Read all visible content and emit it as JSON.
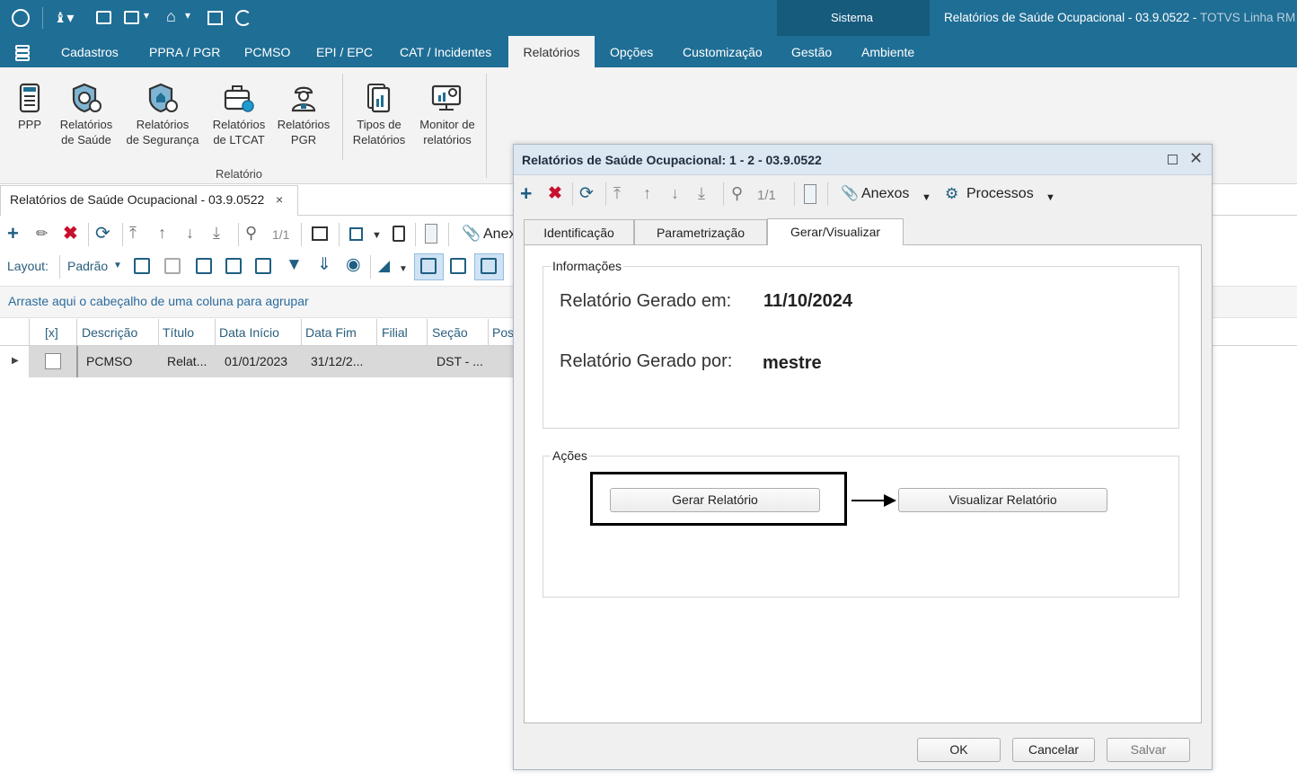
{
  "titlebar": {
    "sistema": "Sistema",
    "app_title": "Relatórios de Saúde Ocupacional - 03.9.0522 - ",
    "app_title_suffix": "TOTVS Linha RM"
  },
  "menu": {
    "items": [
      "Cadastros",
      "PPRA / PGR",
      "PCMSO",
      "EPI / EPC",
      "CAT / Incidentes",
      "Relatórios",
      "Opções",
      "Customização",
      "Gestão",
      "Ambiente"
    ],
    "active": "Relatórios"
  },
  "ribbon": {
    "buttons": [
      {
        "label1": "PPP",
        "label2": "",
        "icon": "ppp-document-icon"
      },
      {
        "label1": "Relatórios",
        "label2": "de Saúde",
        "icon": "health-shield-icon"
      },
      {
        "label1": "Relatórios",
        "label2": "de Segurança",
        "icon": "safety-shield-icon"
      },
      {
        "label1": "Relatórios",
        "label2": "de LTCAT",
        "icon": "briefcase-gear-icon"
      },
      {
        "label1": "Relatórios",
        "label2": "PGR",
        "icon": "worker-icon"
      },
      {
        "label1": "Tipos de",
        "label2": "Relatórios",
        "icon": "report-types-icon"
      },
      {
        "label1": "Monitor de",
        "label2": "relatórios",
        "icon": "monitor-search-icon"
      }
    ],
    "group_label": "Relatório"
  },
  "doc_tab": {
    "label": "Relatórios de Saúde Ocupacional - 03.9.0522",
    "close": "×"
  },
  "grid_toolbar": {
    "page": "1/1",
    "anexos_partial": "Anex",
    "layout_label": "Layout:",
    "layout_value": "Padrão"
  },
  "group_hint": "Arraste aqui o cabeçalho de uma coluna para agrupar",
  "grid": {
    "columns": [
      "[x]",
      "Descrição",
      "Título",
      "Data Início",
      "Data Fim",
      "Filial",
      "Seção",
      "Pos"
    ],
    "rows": [
      {
        "descricao": "PCMSO",
        "titulo": "Relat...",
        "data_inicio": "01/01/2023",
        "data_fim": "31/12/2...",
        "filial": "",
        "secao": "DST - ..."
      }
    ]
  },
  "dialog": {
    "title": "Relatórios de Saúde Ocupacional: 1 - 2 - 03.9.0522",
    "page": "1/1",
    "anexos": "Anexos",
    "processos": "Processos",
    "tabs": [
      "Identificação",
      "Parametrização",
      "Gerar/Visualizar"
    ],
    "active_tab": "Gerar/Visualizar",
    "info_group": "Informações",
    "gerado_em_label": "Relatório Gerado em:",
    "gerado_em_value": "11/10/2024",
    "gerado_por_label": "Relatório Gerado por:",
    "gerado_por_value": "mestre",
    "acoes_group": "Ações",
    "gerar_button": "Gerar Relatório",
    "visualizar_button": "Visualizar Relatório",
    "ok_button": "OK",
    "cancelar_button": "Cancelar",
    "salvar_button": "Salvar"
  },
  "colors": {
    "titlebar": "#1f6e95",
    "accent_dark": "#165a7c",
    "delete_red": "#c8102e",
    "add_blue": "#1f5f82"
  }
}
